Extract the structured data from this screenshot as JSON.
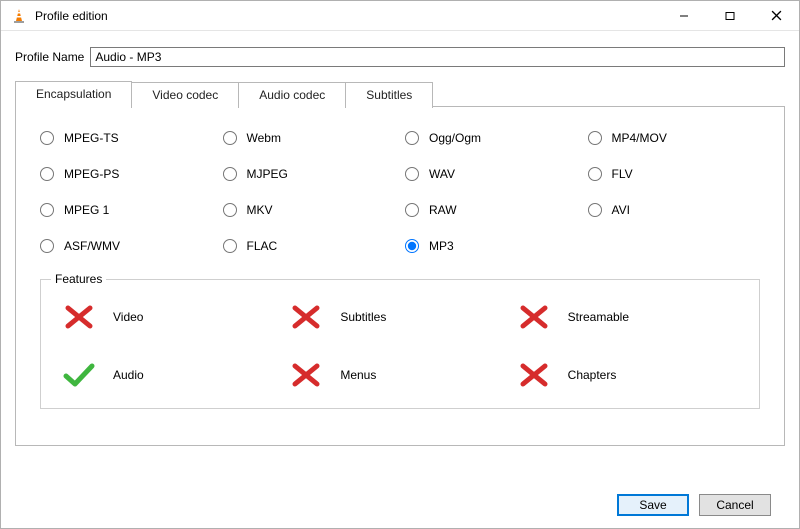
{
  "window": {
    "title": "Profile edition",
    "min_tip": "Minimize",
    "max_tip": "Maximize",
    "close_tip": "Close"
  },
  "profile": {
    "label": "Profile Name",
    "value": "Audio - MP3"
  },
  "tabs": [
    {
      "label": "Encapsulation",
      "active": true
    },
    {
      "label": "Video codec",
      "active": false
    },
    {
      "label": "Audio codec",
      "active": false
    },
    {
      "label": "Subtitles",
      "active": false
    }
  ],
  "radios": [
    {
      "label": "MPEG-TS",
      "selected": false
    },
    {
      "label": "Webm",
      "selected": false
    },
    {
      "label": "Ogg/Ogm",
      "selected": false
    },
    {
      "label": "MP4/MOV",
      "selected": false
    },
    {
      "label": "MPEG-PS",
      "selected": false
    },
    {
      "label": "MJPEG",
      "selected": false
    },
    {
      "label": "WAV",
      "selected": false
    },
    {
      "label": "FLV",
      "selected": false
    },
    {
      "label": "MPEG 1",
      "selected": false
    },
    {
      "label": "MKV",
      "selected": false
    },
    {
      "label": "RAW",
      "selected": false
    },
    {
      "label": "AVI",
      "selected": false
    },
    {
      "label": "ASF/WMV",
      "selected": false
    },
    {
      "label": "FLAC",
      "selected": false
    },
    {
      "label": "MP3",
      "selected": true
    }
  ],
  "features": {
    "title": "Features",
    "items": [
      {
        "label": "Video",
        "ok": false
      },
      {
        "label": "Subtitles",
        "ok": false
      },
      {
        "label": "Streamable",
        "ok": false
      },
      {
        "label": "Audio",
        "ok": true
      },
      {
        "label": "Menus",
        "ok": false
      },
      {
        "label": "Chapters",
        "ok": false
      }
    ]
  },
  "buttons": {
    "save": "Save",
    "cancel": "Cancel"
  },
  "colors": {
    "cross": "#d62c2c",
    "check": "#3fb63f",
    "accent": "#0078d7"
  }
}
